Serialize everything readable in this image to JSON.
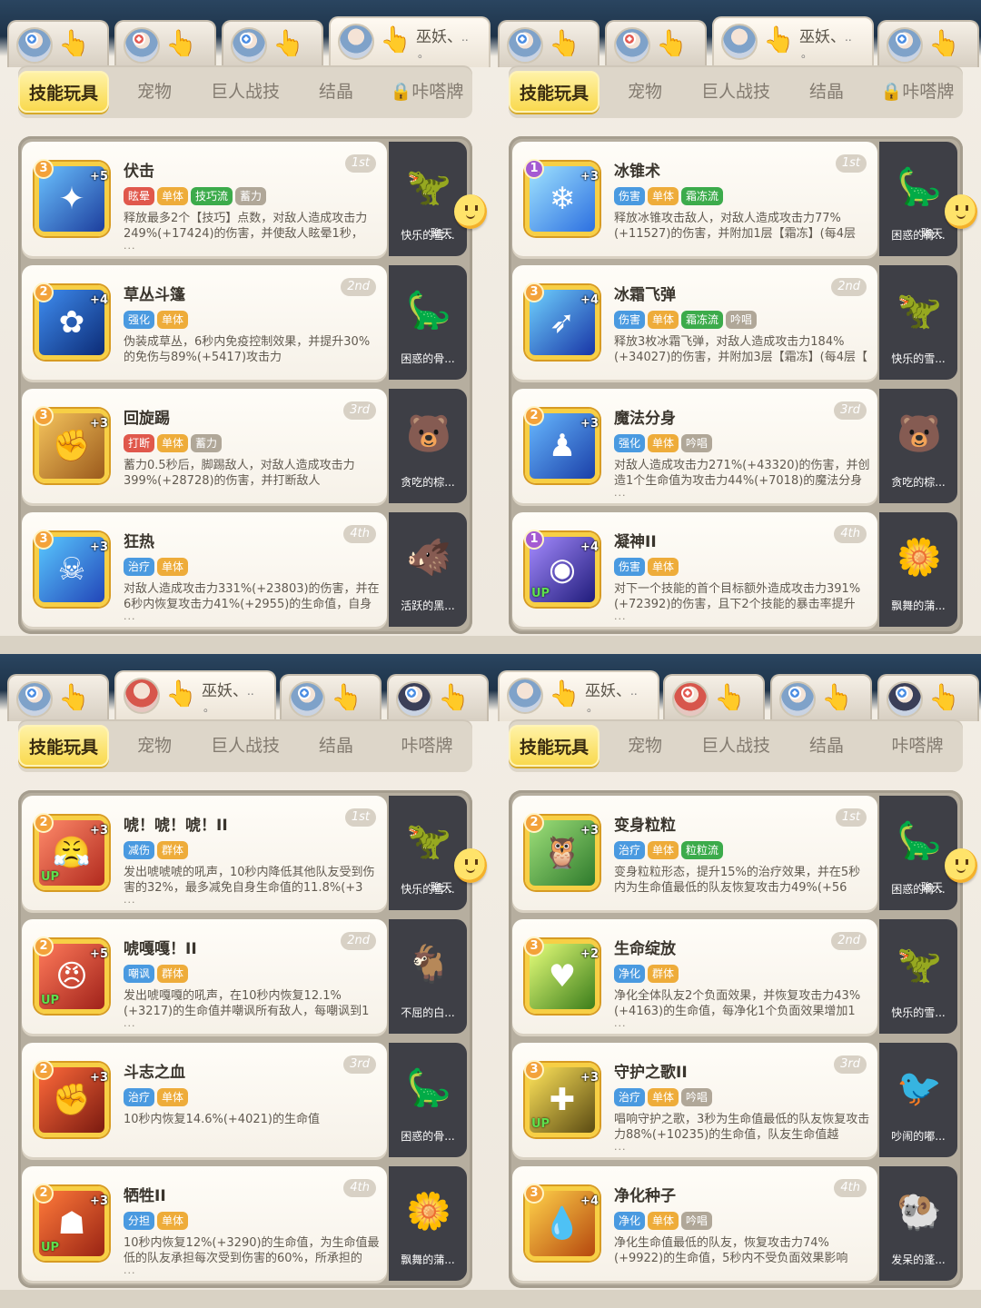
{
  "tag_colors": {
    "red": "#e0584c",
    "orange": "#eeac3a",
    "green": "#3cab4b",
    "blue": "#4a9ae0",
    "gray": "#b0a798"
  },
  "chat_label": "聊天",
  "quadrants": [
    {
      "players": [
        {
          "name": "",
          "badge": "blue",
          "hand": "👆"
        },
        {
          "name": "",
          "badge": "red",
          "hand": "👆"
        },
        {
          "name": "",
          "badge": "blue",
          "hand": "👆"
        },
        {
          "name": "巫妖、",
          "more": "..",
          "dot": "。",
          "hand": "👆",
          "active": true
        }
      ],
      "menu": [
        "技能玩具",
        "宠物",
        "巨人战技",
        "结晶",
        "🔒咔嗒牌"
      ],
      "cards": [
        {
          "name": "伏击",
          "level": "3",
          "plus": "+5",
          "rank": "1st",
          "tags": [
            [
              "眩晕",
              "red"
            ],
            [
              "单体",
              "orange"
            ],
            [
              "技巧流",
              "green"
            ],
            [
              "蓄力",
              "gray"
            ]
          ],
          "desc": "释放最多2个【技巧】点数，对敌人造成攻击力249%(+17424)的伤害，并使敌人眩晕1秒，",
          "dots": "...",
          "icon": "✦",
          "iconbg": "linear-gradient(135deg,#6ac1ff,#1d3e9d)",
          "pet": "快乐的雪...",
          "peticon": "🦖"
        },
        {
          "name": "草丛斗篷",
          "level": "2",
          "plus": "+4",
          "rank": "2nd",
          "tags": [
            [
              "强化",
              "blue"
            ],
            [
              "单体",
              "orange"
            ]
          ],
          "desc": "伪装成草丛，6秒内免疫控制效果，并提升30%的免伤与89%(+5417)攻击力",
          "dots": "",
          "icon": "✿",
          "iconbg": "linear-gradient(135deg,#3f8df0,#0c2b76)",
          "pet": "困惑的骨...",
          "peticon": "🦕"
        },
        {
          "name": "回旋踢",
          "level": "3",
          "plus": "+3",
          "rank": "3rd",
          "tags": [
            [
              "打断",
              "red"
            ],
            [
              "单体",
              "orange"
            ],
            [
              "蓄力",
              "gray"
            ]
          ],
          "desc": "蓄力0.5秒后，脚踢敌人，对敌人造成攻击力399%(+28728)的伤害，并打断敌人",
          "dots": "",
          "icon": "✊",
          "iconbg": "linear-gradient(135deg,#f5c45c,#9b5a1c)",
          "pet": "贪吃的棕...",
          "peticon": "🐻"
        },
        {
          "name": "狂热",
          "level": "3",
          "plus": "+3",
          "rank": "4th",
          "tags": [
            [
              "治疗",
              "blue"
            ],
            [
              "单体",
              "orange"
            ]
          ],
          "desc": "对敌人造成攻击力331%(+23803)的伤害，并在6秒内恢复攻击力41%(+2955)的生命值，自身",
          "dots": "...",
          "icon": "☠",
          "iconbg": "linear-gradient(135deg,#59c8ff,#2245b8)",
          "pet": "活跃的黑...",
          "peticon": "🐗"
        }
      ]
    },
    {
      "players": [
        {
          "name": "",
          "badge": "blue",
          "hand": "👆"
        },
        {
          "name": "",
          "badge": "red",
          "hand": "👆"
        },
        {
          "name": "巫妖、",
          "more": "..",
          "dot": "。",
          "hand": "👆",
          "active": true
        },
        {
          "name": "",
          "badge": "blue",
          "hand": "👆"
        }
      ],
      "menu": [
        "技能玩具",
        "宠物",
        "巨人战技",
        "结晶",
        "🔒咔嗒牌"
      ],
      "cards": [
        {
          "name": "冰锥术",
          "level": "1",
          "plus": "+3",
          "rank": "1st",
          "lvlpurple": true,
          "tags": [
            [
              "伤害",
              "blue"
            ],
            [
              "单体",
              "orange"
            ],
            [
              "霜冻流",
              "green"
            ]
          ],
          "desc": "释放冰锥攻击敌人，对敌人造成攻击力77%(+11527)的伤害，并附加1层【霜冻】(每4层【霜",
          "dots": "",
          "icon": "❄",
          "iconbg": "linear-gradient(135deg,#9fe3ff,#2c6fe0)",
          "pet": "困惑的骨...",
          "peticon": "🦕"
        },
        {
          "name": "冰霜飞弹",
          "level": "3",
          "plus": "+4",
          "rank": "2nd",
          "tags": [
            [
              "伤害",
              "blue"
            ],
            [
              "单体",
              "orange"
            ],
            [
              "霜冻流",
              "green"
            ],
            [
              "吟唱",
              "gray"
            ]
          ],
          "desc": "释放3枚冰霜飞弹，对敌人造成攻击力184%(+34027)的伤害，并附加3层【霜冻】(每4层【",
          "dots": "",
          "icon": "➶",
          "iconbg": "linear-gradient(135deg,#6fd2ff,#1834a6)",
          "pet": "快乐的雪...",
          "peticon": "🦖"
        },
        {
          "name": "魔法分身",
          "level": "2",
          "plus": "+3",
          "rank": "3rd",
          "tags": [
            [
              "强化",
              "blue"
            ],
            [
              "单体",
              "orange"
            ],
            [
              "吟唱",
              "gray"
            ]
          ],
          "desc": "对敌人造成攻击力271%(+43320)的伤害，并创造1个生命值为攻击力44%(+7018)的魔法分身",
          "dots": "...",
          "icon": "♟",
          "iconbg": "linear-gradient(135deg,#67b8ff,#1a3fa8)",
          "pet": "贪吃的棕...",
          "peticon": "🐻"
        },
        {
          "name": "凝神II",
          "level": "1",
          "plus": "+4",
          "rank": "4th",
          "lvlpurple": true,
          "up": true,
          "tags": [
            [
              "伤害",
              "blue"
            ],
            [
              "单体",
              "orange"
            ]
          ],
          "desc": "对下一个技能的首个目标额外造成攻击力391%(+72392)的伤害，且下2个技能的暴击率提升",
          "dots": "...",
          "icon": "◉",
          "iconbg": "linear-gradient(135deg,#a58bff,#1f1b7a)",
          "pet": "飘舞的蒲...",
          "peticon": "🌼"
        }
      ]
    },
    {
      "players": [
        {
          "name": "",
          "badge": "blue",
          "hand": "👆"
        },
        {
          "name": "巫妖、",
          "more": "..",
          "dot": "。",
          "hand": "👆",
          "active": true,
          "red": true
        },
        {
          "name": "",
          "badge": "blue",
          "hand": "👆"
        },
        {
          "name": "",
          "badge": "blue",
          "hand": "👆",
          "dark": true
        }
      ],
      "menu": [
        "技能玩具",
        "宠物",
        "巨人战技",
        "结晶",
        "咔嗒牌"
      ],
      "cards": [
        {
          "name": "唬！唬！唬！II",
          "level": "2",
          "plus": "+3",
          "rank": "1st",
          "up": true,
          "tags": [
            [
              "减伤",
              "blue"
            ],
            [
              "群体",
              "orange"
            ]
          ],
          "desc": "发出唬唬唬的吼声，10秒内降低其他队友受到伤害的32%，最多减免自身生命值的11.8%(+3",
          "dots": "...",
          "icon": "😤",
          "iconbg": "linear-gradient(135deg,#ff8a6a,#b12a1e)",
          "pet": "快乐的雪...",
          "peticon": "🦖"
        },
        {
          "name": "唬嘎嘎！II",
          "level": "2",
          "plus": "+5",
          "rank": "2nd",
          "up": true,
          "tags": [
            [
              "嘲讽",
              "blue"
            ],
            [
              "群体",
              "orange"
            ]
          ],
          "desc": "发出唬嘎嘎的吼声，在10秒内恢复12.1%(+3217)的生命值并嘲讽所有敌人，每嘲讽到1个敌",
          "dots": "...",
          "icon": "😠",
          "iconbg": "linear-gradient(135deg,#ff7a5a,#a0221a)",
          "pet": "不屈的白...",
          "peticon": "🐐"
        },
        {
          "name": "斗志之血",
          "level": "2",
          "plus": "+3",
          "rank": "3rd",
          "tags": [
            [
              "治疗",
              "blue"
            ],
            [
              "单体",
              "orange"
            ]
          ],
          "desc": "10秒内恢复14.6%(+4021)的生命值",
          "dots": "",
          "icon": "✊",
          "iconbg": "linear-gradient(135deg,#ff6a3a,#7a1a10)",
          "pet": "困惑的骨...",
          "peticon": "🦕"
        },
        {
          "name": "牺牲II",
          "level": "2",
          "plus": "+3",
          "rank": "4th",
          "up": true,
          "tags": [
            [
              "分担",
              "blue"
            ],
            [
              "单体",
              "orange"
            ]
          ],
          "desc": "10秒内恢复12%(+3290)的生命值，为生命值最低的队友承担每次受到伤害的60%，所承担的",
          "dots": "...",
          "icon": "☗",
          "iconbg": "linear-gradient(135deg,#ff7a3a,#9a2414)",
          "pet": "飘舞的蒲...",
          "peticon": "🌼"
        }
      ]
    },
    {
      "players": [
        {
          "name": "巫妖、",
          "more": "..",
          "dot": "。",
          "hand": "👆",
          "active": true
        },
        {
          "name": "",
          "badge": "red",
          "hand": "👆",
          "red": true
        },
        {
          "name": "",
          "badge": "blue",
          "hand": "👆"
        },
        {
          "name": "",
          "badge": "blue",
          "hand": "👆",
          "dark": true
        }
      ],
      "menu": [
        "技能玩具",
        "宠物",
        "巨人战技",
        "结晶",
        "咔嗒牌"
      ],
      "cards": [
        {
          "name": "变身粒粒",
          "level": "2",
          "plus": "+3",
          "rank": "1st",
          "tags": [
            [
              "治疗",
              "blue"
            ],
            [
              "单体",
              "orange"
            ],
            [
              "粒粒流",
              "green"
            ]
          ],
          "desc": "变身粒粒形态，提升15%的治疗效果，并在5秒内为生命值最低的队友恢复攻击力49%(+56",
          "dots": "",
          "icon": "🦉",
          "iconbg": "linear-gradient(135deg,#9fe07a,#2e7a2c)",
          "pet": "困惑的骨...",
          "peticon": "🦕"
        },
        {
          "name": "生命绽放",
          "level": "3",
          "plus": "+2",
          "rank": "2nd",
          "tags": [
            [
              "净化",
              "blue"
            ],
            [
              "群体",
              "orange"
            ]
          ],
          "desc": "净化全体队友2个负面效果，并恢复攻击力43%(+4163)的生命值，每净化1个负面效果增加1",
          "dots": "...",
          "icon": "♥",
          "iconbg": "linear-gradient(135deg,#e7ff7a,#3b7d1a)",
          "pet": "快乐的雪...",
          "peticon": "🦖"
        },
        {
          "name": "守护之歌II",
          "level": "3",
          "plus": "+3",
          "rank": "3rd",
          "up": true,
          "tags": [
            [
              "治疗",
              "blue"
            ],
            [
              "单体",
              "orange"
            ],
            [
              "吟唱",
              "gray"
            ]
          ],
          "desc": "唱响守护之歌，3秒为生命值最低的队友恢复攻击力88%(+10235)的生命值，队友生命值越",
          "dots": "...",
          "icon": "✚",
          "iconbg": "linear-gradient(135deg,#ffe45a,#5a4a12)",
          "pet": "吵闹的嘟...",
          "peticon": "🐦"
        },
        {
          "name": "净化种子",
          "level": "3",
          "plus": "+4",
          "rank": "4th",
          "tags": [
            [
              "净化",
              "blue"
            ],
            [
              "单体",
              "orange"
            ],
            [
              "吟唱",
              "gray"
            ]
          ],
          "desc": "净化生命值最低的队友，恢复攻击力74%(+9922)的生命值，5秒内不受负面效果影响",
          "dots": "",
          "icon": "💧",
          "iconbg": "linear-gradient(135deg,#ffd24a,#b5470e)",
          "pet": "发呆的蓬...",
          "peticon": "🐏"
        }
      ]
    }
  ]
}
